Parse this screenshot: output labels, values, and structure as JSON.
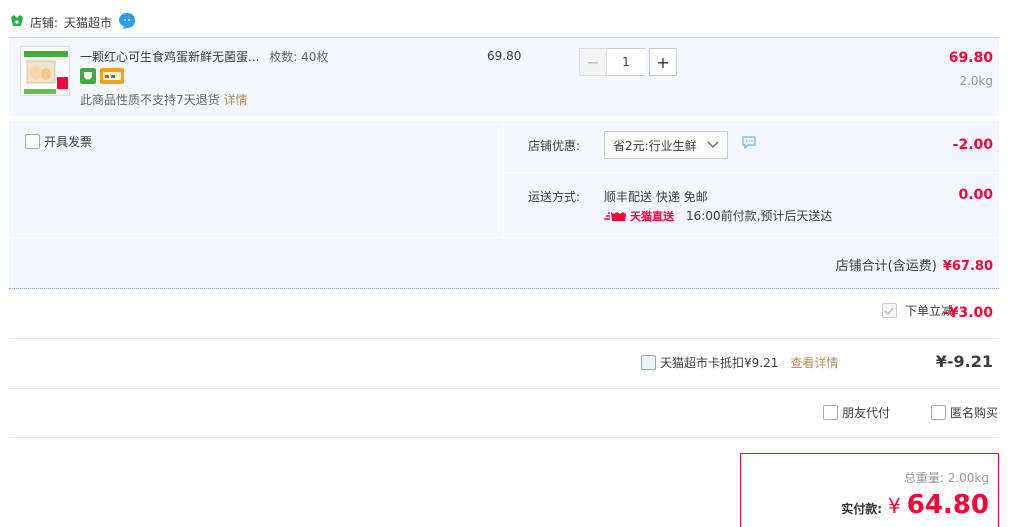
{
  "shop": {
    "label": "店铺:",
    "name": "天猫超市"
  },
  "item": {
    "title": "一颗红心可生食鸡蛋新鲜无菌蛋...",
    "spec": "枚数: 40枚",
    "note": "此商品性质不支持7天退货",
    "detail_link": "详情",
    "unit_price": "69.80",
    "quantity": "1",
    "minus": "−",
    "plus": "+",
    "subtotal": "69.80",
    "weight": "2.0kg"
  },
  "invoice": {
    "label": "开具发票"
  },
  "promo": {
    "label": "店铺优惠:",
    "selected": "省2元:行业生鲜",
    "amount": "-2.00"
  },
  "shipping": {
    "label": "运送方式:",
    "method": "顺丰配送 快递 免邮",
    "tmall_direct": "天猫直送",
    "eta": "16:00前付款,预计后天送达",
    "amount": "0.00"
  },
  "shop_total": {
    "label": "店铺合计(含运费)",
    "amount": "¥67.80"
  },
  "instant_discount": {
    "label": "下单立减",
    "amount": "-¥3.00"
  },
  "supermarket_card": {
    "label": "天猫超市卡抵扣¥9.21",
    "detail_link": "查看详情",
    "amount": "¥-9.21"
  },
  "options": {
    "friend_pay": "朋友代付",
    "anonymous": "匿名购买"
  },
  "payment": {
    "weight_label": "总重量: 2.00kg",
    "pay_label": "实付款:",
    "currency": "¥",
    "amount": "64.80"
  },
  "colors": {
    "accent": "#ff0036",
    "panel": "#f3f7ff",
    "link": "#b48c5a"
  }
}
